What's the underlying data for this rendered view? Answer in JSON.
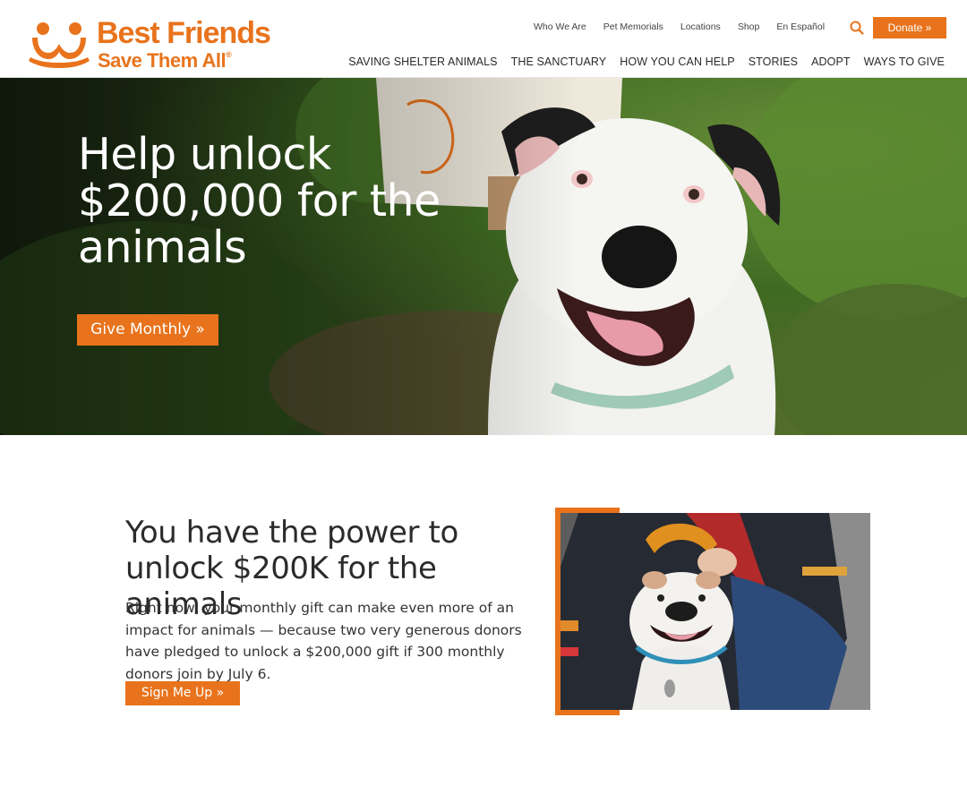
{
  "brand": {
    "name_line1": "Best Friends",
    "name_line2": "Save Them All",
    "registered": "®",
    "accent_color": "#e8731c"
  },
  "utility_nav": {
    "items": [
      "Who We Are",
      "Pet Memorials",
      "Locations",
      "Shop",
      "En Español"
    ],
    "search_icon": "search-icon",
    "donate_label": "Donate »"
  },
  "main_nav": {
    "items": [
      "SAVING SHELTER ANIMALS",
      "THE SANCTUARY",
      "HOW YOU CAN HELP",
      "STORIES",
      "ADOPT",
      "WAYS TO GIVE"
    ]
  },
  "hero": {
    "title": "Help unlock $200,000 for the animals",
    "button_label": "Give Monthly »"
  },
  "feature": {
    "title": "You have the power to unlock $200K for the animals",
    "body": "Right now, your monthly gift can make even more of an impact for animals — because two very generous donors have pledged to unlock a $200,000 gift if 300 monthly donors join by July 6.",
    "button_label": "Sign Me Up »"
  }
}
